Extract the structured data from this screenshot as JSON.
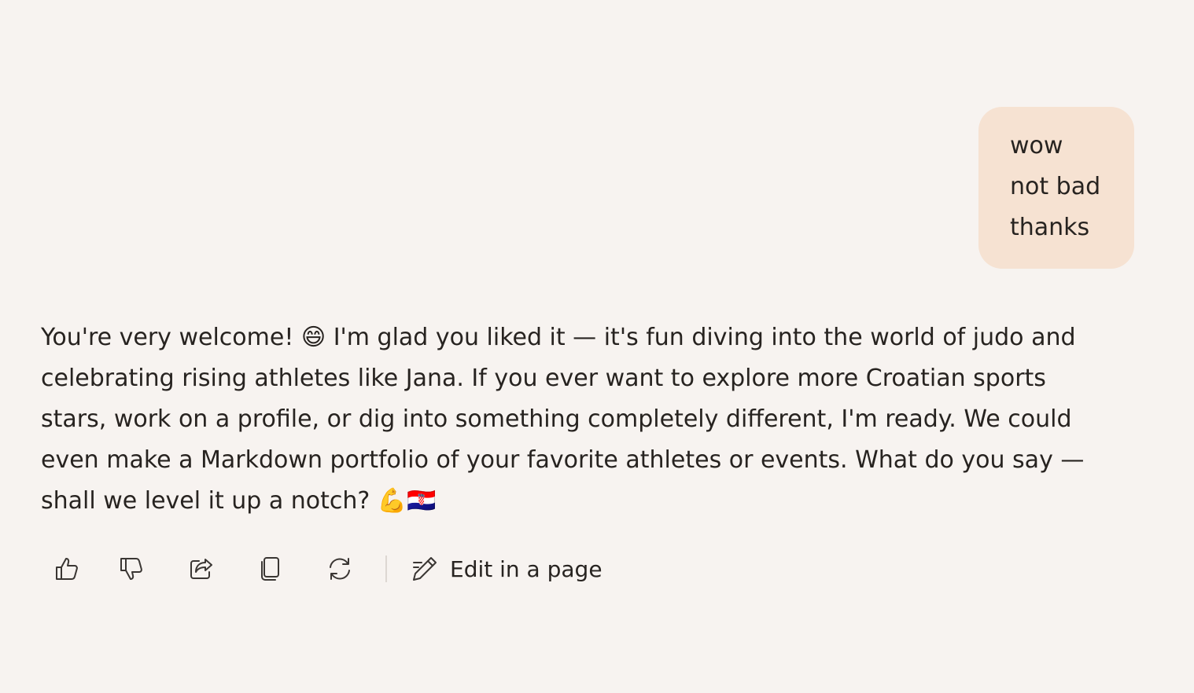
{
  "user_message": {
    "lines": [
      "wow",
      "not bad",
      "thanks"
    ]
  },
  "assistant_message": {
    "text": "You're very welcome! 😄 I'm glad you liked it — it's fun diving into the world of judo and celebrating rising athletes like Jana. If you ever want to explore more Croatian sports stars, work on a profile, or dig into something completely different, I'm ready. We could even make a Markdown portfolio of your favorite athletes or events. What do you say — shall we level it up a notch? 💪🇭🇷"
  },
  "actions": {
    "icons": [
      "thumbs-up-icon",
      "thumbs-down-icon",
      "share-icon",
      "copy-icon",
      "regenerate-icon",
      "edit-pencil-icon"
    ],
    "edit_label": "Edit in a page"
  },
  "colors": {
    "background": "#f7f3f0",
    "user_bubble": "#f6e2d2",
    "text": "#272320",
    "icon_stroke": "#3a3633"
  }
}
